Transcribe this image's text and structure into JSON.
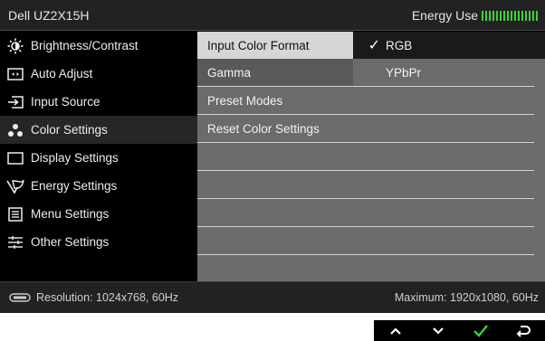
{
  "header": {
    "title": "Dell UZ2X15H",
    "energy_label": "Energy Use"
  },
  "menu": {
    "items": [
      {
        "label": "Brightness/Contrast",
        "icon": "brightness-icon",
        "selected": false
      },
      {
        "label": "Auto Adjust",
        "icon": "auto-adjust-icon",
        "selected": false
      },
      {
        "label": "Input Source",
        "icon": "input-source-icon",
        "selected": false
      },
      {
        "label": "Color Settings",
        "icon": "color-settings-icon",
        "selected": true
      },
      {
        "label": "Display Settings",
        "icon": "display-settings-icon",
        "selected": false
      },
      {
        "label": "Energy Settings",
        "icon": "energy-settings-icon",
        "selected": false
      },
      {
        "label": "Menu Settings",
        "icon": "menu-settings-icon",
        "selected": false
      },
      {
        "label": "Other Settings",
        "icon": "other-settings-icon",
        "selected": false
      }
    ]
  },
  "submenu": {
    "items": [
      {
        "label": "Input Color Format",
        "active": true
      },
      {
        "label": "Gamma",
        "active": false
      },
      {
        "label": "Preset Modes",
        "active": false
      },
      {
        "label": "Reset Color Settings",
        "active": false
      }
    ]
  },
  "options": {
    "items": [
      {
        "label": "RGB",
        "checked": true
      },
      {
        "label": "YPbPr",
        "checked": false
      }
    ],
    "check_glyph": "✓"
  },
  "footer": {
    "resolution": "Resolution: 1024x768, 60Hz",
    "maximum": "Maximum: 1920x1080, 60Hz"
  },
  "buttons": [
    {
      "icon": "up-arrow-icon",
      "glyph": "∧"
    },
    {
      "icon": "down-arrow-icon",
      "glyph": "∨"
    },
    {
      "icon": "check-icon",
      "glyph": "✓"
    },
    {
      "icon": "back-icon",
      "glyph": "↩"
    }
  ],
  "colors": {
    "check_green": "#3ad33a",
    "energy_green": "#3ad33a"
  }
}
